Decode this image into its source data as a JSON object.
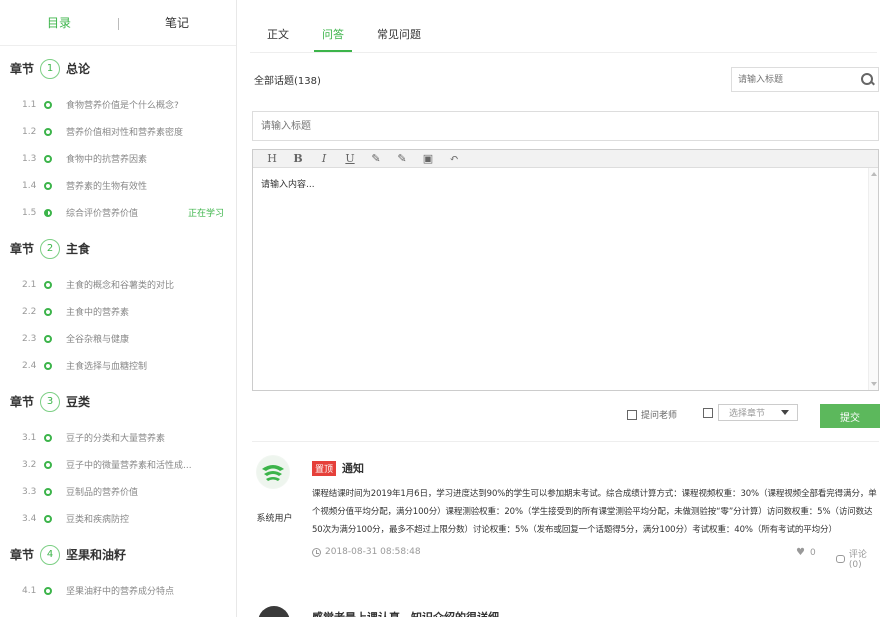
{
  "sidebar": {
    "tabs": [
      {
        "label": "目录",
        "active": true
      },
      {
        "label": "笔记",
        "active": false
      }
    ],
    "chapter_prefix": "章节",
    "chapters": [
      {
        "num": "1",
        "title": "总论",
        "lessons": [
          {
            "num": "1.1",
            "title": "食物营养价值是个什么概念?",
            "status": "",
            "progress": 0
          },
          {
            "num": "1.2",
            "title": "营养价值相对性和营养素密度",
            "status": "",
            "progress": 0
          },
          {
            "num": "1.3",
            "title": "食物中的抗营养因素",
            "status": "",
            "progress": 0
          },
          {
            "num": "1.4",
            "title": "营养素的生物有效性",
            "status": "",
            "progress": 0
          },
          {
            "num": "1.5",
            "title": "综合评价营养价值",
            "status": "正在学习",
            "progress": 0.5
          }
        ]
      },
      {
        "num": "2",
        "title": "主食",
        "lessons": [
          {
            "num": "2.1",
            "title": "主食的概念和谷薯类的对比",
            "status": "",
            "progress": 0
          },
          {
            "num": "2.2",
            "title": "主食中的营养素",
            "status": "",
            "progress": 0
          },
          {
            "num": "2.3",
            "title": "全谷杂粮与健康",
            "status": "",
            "progress": 0
          },
          {
            "num": "2.4",
            "title": "主食选择与血糖控制",
            "status": "",
            "progress": 0
          }
        ]
      },
      {
        "num": "3",
        "title": "豆类",
        "lessons": [
          {
            "num": "3.1",
            "title": "豆子的分类和大量营养素",
            "status": "",
            "progress": 0
          },
          {
            "num": "3.2",
            "title": "豆子中的微量营养素和活性成...",
            "status": "",
            "progress": 0
          },
          {
            "num": "3.3",
            "title": "豆制品的营养价值",
            "status": "",
            "progress": 0
          },
          {
            "num": "3.4",
            "title": "豆类和疾病防控",
            "status": "",
            "progress": 0
          }
        ]
      },
      {
        "num": "4",
        "title": "坚果和油籽",
        "lessons": [
          {
            "num": "4.1",
            "title": "坚果油籽中的营养成分特点",
            "status": "",
            "progress": 0
          }
        ]
      }
    ]
  },
  "main": {
    "tabs": [
      {
        "label": "正文",
        "active": false
      },
      {
        "label": "问答",
        "active": true
      },
      {
        "label": "常见问题",
        "active": false
      }
    ],
    "topics_count_label": "全部话题(138)",
    "search_placeholder": "请输入标题",
    "title_placeholder": "请输入标题",
    "editor": {
      "toolbar": [
        "H",
        "B",
        "I",
        "U",
        "pen",
        "brush",
        "image",
        "undo"
      ],
      "content": "请输入内容..."
    },
    "ask_teacher_label": "提问老师",
    "chapter_select_value": "选择章节",
    "submit_label": "提交"
  },
  "posts": [
    {
      "author": "系统用户",
      "badge": "置顶",
      "title": "通知",
      "body": "课程结课时间为2019年1月6日，学习进度达到90%的学生可以参加期末考试。综合成绩计算方式：课程视频权重：30%（课程视频全部看完得满分，单个视频分值平均分配，满分100分）课程测验权重：20%（学生接受到的所有课堂测验平均分配，未做测验按“零”分计算）访问数权重：5%（访问数达50次为满分100分，最多不超过上限分数）讨论权重：5%（发布或回复一个话题得5分，满分100分）考试权重：40%（所有考试的平均分）",
      "time": "2018-08-31 08:58:48",
      "likes": "0",
      "comments": "评论(0)"
    },
    {
      "title": "感觉老是上课认真，知识介绍的很详细"
    }
  ]
}
